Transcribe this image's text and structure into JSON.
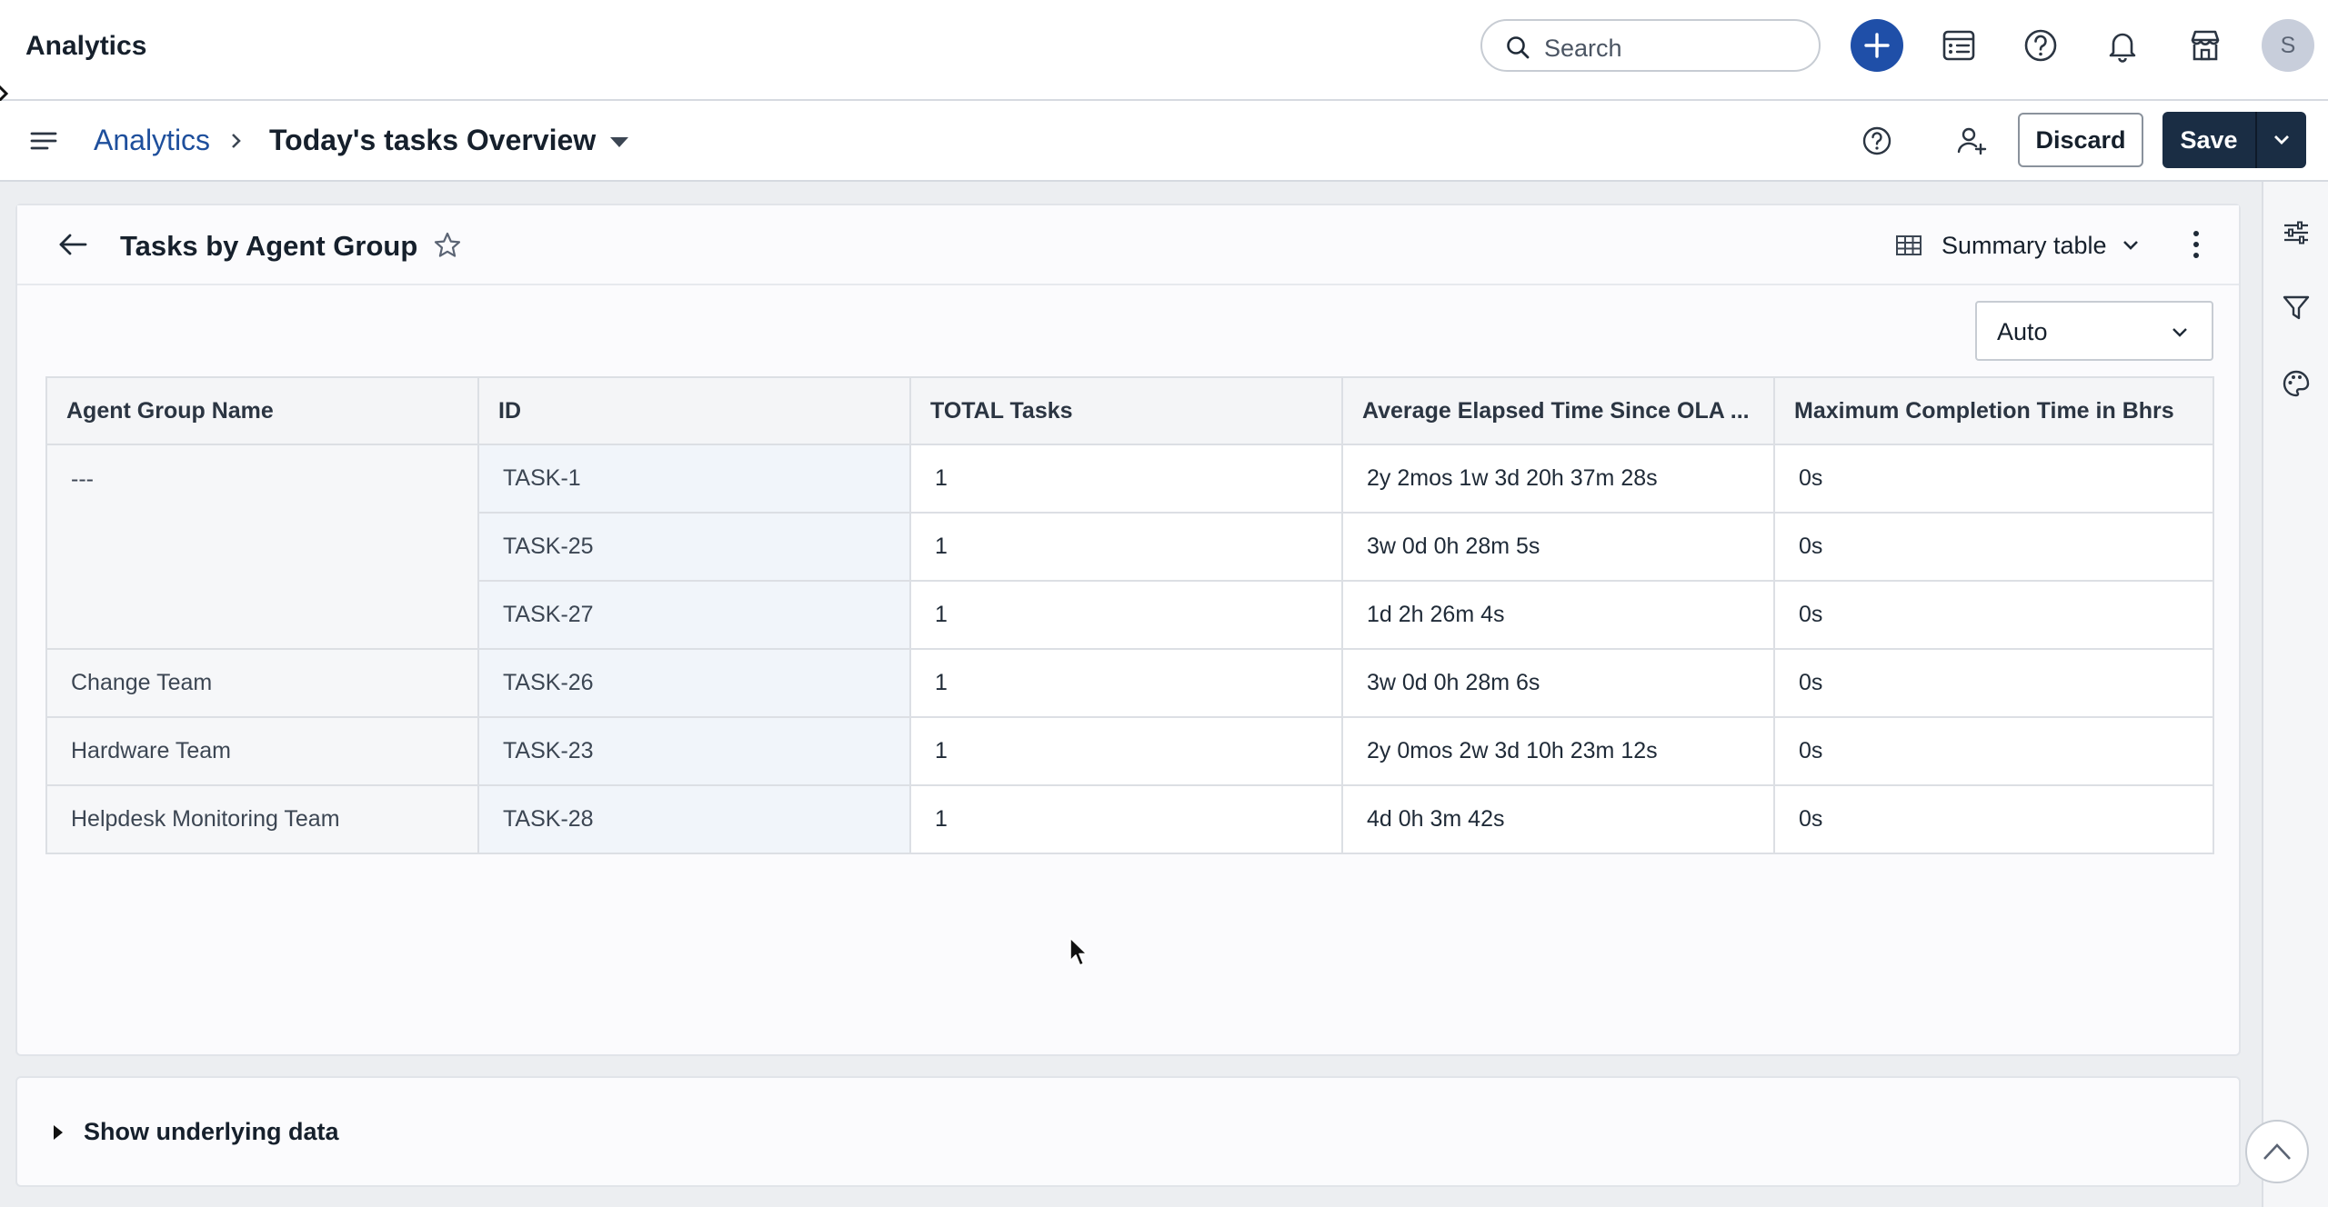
{
  "header": {
    "app_title": "Analytics",
    "search_placeholder": "Search",
    "avatar_initial": "S"
  },
  "breadcrumb": {
    "root": "Analytics",
    "current": "Today's tasks Overview"
  },
  "actions": {
    "discard_label": "Discard",
    "save_label": "Save"
  },
  "report": {
    "title": "Tasks by Agent Group",
    "visualization_type": "Summary table",
    "size_mode": "Auto",
    "columns": [
      "Agent Group Name",
      "ID",
      "TOTAL Tasks",
      "Average Elapsed Time Since OLA ...",
      "Maximum Completion Time in Bhrs"
    ],
    "groups": [
      {
        "name": "---",
        "rows": [
          {
            "id": "TASK-1",
            "total": "1",
            "avg": "2y 2mos 1w 3d 20h 37m 28s",
            "max": "0s"
          },
          {
            "id": "TASK-25",
            "total": "1",
            "avg": "3w 0d 0h 28m 5s",
            "max": "0s"
          },
          {
            "id": "TASK-27",
            "total": "1",
            "avg": "1d 2h 26m 4s",
            "max": "0s"
          }
        ]
      },
      {
        "name": "Change Team",
        "rows": [
          {
            "id": "TASK-26",
            "total": "1",
            "avg": "3w 0d 0h 28m 6s",
            "max": "0s"
          }
        ]
      },
      {
        "name": "Hardware Team",
        "rows": [
          {
            "id": "TASK-23",
            "total": "1",
            "avg": "2y 0mos 2w 3d 10h 23m 12s",
            "max": "0s"
          }
        ]
      },
      {
        "name": "Helpdesk Monitoring Team",
        "rows": [
          {
            "id": "TASK-28",
            "total": "1",
            "avg": "4d 0h 3m 42s",
            "max": "0s"
          }
        ]
      }
    ]
  },
  "underlying": {
    "label": "Show underlying data"
  },
  "colors": {
    "primary_blue": "#1f4fa8",
    "save_dark": "#1a2d44",
    "link_blue": "#1e4f9c"
  },
  "icons": {
    "header": [
      "search-icon",
      "plus-icon",
      "service-catalog-icon",
      "help-icon",
      "bell-icon",
      "store-icon"
    ],
    "rail": [
      "settings-sliders-icon",
      "filter-icon",
      "palette-icon"
    ]
  }
}
